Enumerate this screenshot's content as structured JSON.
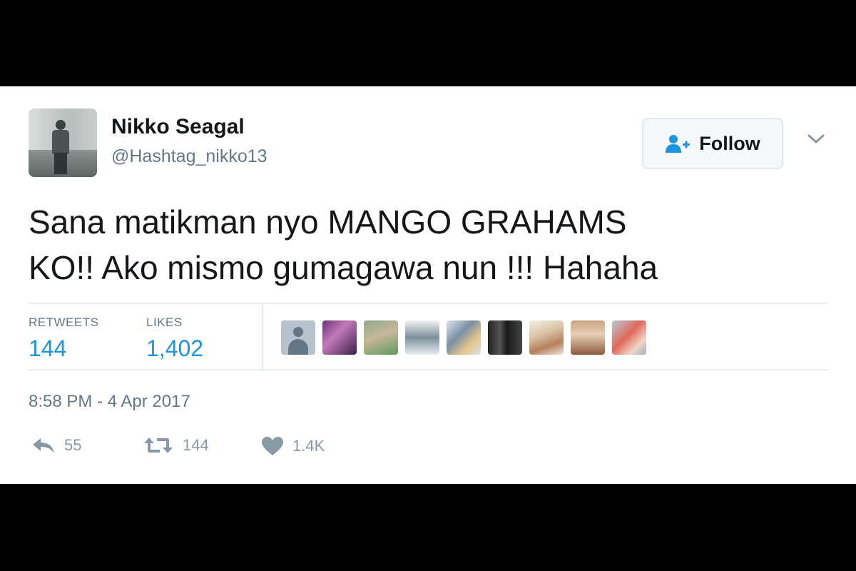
{
  "tweet": {
    "author": {
      "display_name": "Nikko Seagal",
      "handle": "@Hashtag_nikko13"
    },
    "follow_label": "Follow",
    "text_lines": [
      "Sana matikman nyo MANGO GRAHAMS",
      "KO!! Ako mismo gumagawa nun !!! Hahaha"
    ],
    "stats": {
      "retweets_label": "RETWEETS",
      "retweets_value": "144",
      "likes_label": "LIKES",
      "likes_value": "1,402"
    },
    "timestamp": "8:58 PM - 4 Apr 2017",
    "actions": {
      "reply_count": "55",
      "retweet_count": "144",
      "like_count": "1.4K"
    }
  },
  "icons": {
    "follow": "user-plus-icon",
    "caret": "chevron-down-icon",
    "reply": "reply-icon",
    "retweet": "retweet-icon",
    "like": "heart-icon"
  },
  "colors": {
    "accent": "#1b95e0",
    "text": "#14171a",
    "muted": "#657786",
    "action": "#8899a6",
    "divider": "#e6ecf0"
  }
}
